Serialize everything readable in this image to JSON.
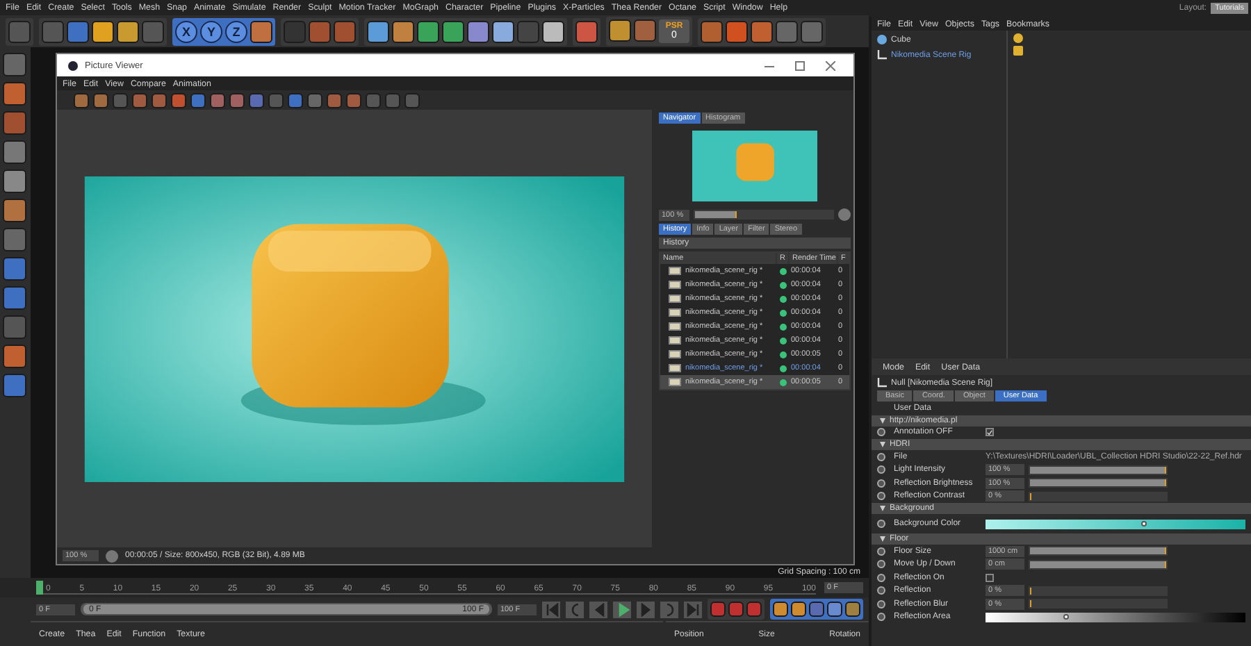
{
  "menu_bar": [
    "File",
    "Edit",
    "Create",
    "Select",
    "Tools",
    "Mesh",
    "Snap",
    "Animate",
    "Simulate",
    "Render",
    "Sculpt",
    "Motion Tracker",
    "MoGraph",
    "Character",
    "Pipeline",
    "Plugins",
    "X-Particles",
    "Thea Render",
    "Octane",
    "Script",
    "Window",
    "Help"
  ],
  "axis_buttons": [
    {
      "label": "X",
      "selected": true
    },
    {
      "label": "Y",
      "selected": true
    },
    {
      "label": "Z",
      "selected": true
    }
  ],
  "psr_badge": {
    "label": "PSR",
    "value": "0"
  },
  "layout": {
    "label": "Layout:",
    "value": "Tutorials"
  },
  "viewport": {
    "grid_spacing": "Grid Spacing : 100 cm"
  },
  "picture_viewer": {
    "title": "Picture Viewer",
    "menu": [
      "File",
      "Edit",
      "View",
      "Compare",
      "Animation"
    ],
    "zoom": "100 %",
    "status": "00:00:05 / Size: 800x450, RGB (32 Bit), 4.89 MB",
    "navigator_tabs": [
      {
        "label": "Navigator",
        "selected": true
      },
      {
        "label": "Histogram",
        "selected": false
      }
    ],
    "navigator_zoom": "100 %",
    "navigator_slider": {
      "level": 0.3
    },
    "history_tabs": [
      {
        "label": "History",
        "selected": true
      },
      {
        "label": "Info",
        "selected": false
      },
      {
        "label": "Layer",
        "selected": false
      },
      {
        "label": "Filter",
        "selected": false
      },
      {
        "label": "Stereo",
        "selected": false
      }
    ],
    "history_title": "History",
    "columns": [
      "Name",
      "R",
      "Render Time",
      "F"
    ],
    "rows": [
      {
        "name": "nikomedia_scene_rig *",
        "time": "00:00:04",
        "frame": "0",
        "selected": false,
        "current": false
      },
      {
        "name": "nikomedia_scene_rig *",
        "time": "00:00:04",
        "frame": "0",
        "selected": false,
        "current": false
      },
      {
        "name": "nikomedia_scene_rig *",
        "time": "00:00:04",
        "frame": "0",
        "selected": false,
        "current": false
      },
      {
        "name": "nikomedia_scene_rig *",
        "time": "00:00:04",
        "frame": "0",
        "selected": false,
        "current": false
      },
      {
        "name": "nikomedia_scene_rig *",
        "time": "00:00:04",
        "frame": "0",
        "selected": false,
        "current": false
      },
      {
        "name": "nikomedia_scene_rig *",
        "time": "00:00:04",
        "frame": "0",
        "selected": false,
        "current": false
      },
      {
        "name": "nikomedia_scene_rig *",
        "time": "00:00:05",
        "frame": "0",
        "selected": false,
        "current": false
      },
      {
        "name": "nikomedia_scene_rig *",
        "time": "00:00:04",
        "frame": "0",
        "selected": false,
        "current": true
      },
      {
        "name": "nikomedia_scene_rig *",
        "time": "00:00:05",
        "frame": "0",
        "selected": true,
        "current": false
      }
    ]
  },
  "object_manager": {
    "menu": [
      "File",
      "Edit",
      "View",
      "Objects",
      "Tags",
      "Bookmarks"
    ],
    "objects": [
      {
        "name": "Cube",
        "kind": "cube",
        "selected": false
      },
      {
        "name": "Nikomedia Scene Rig",
        "kind": "null",
        "selected": true
      }
    ]
  },
  "attributes": {
    "menu": [
      "Mode",
      "Edit",
      "User Data"
    ],
    "title": "Null [Nikomedia Scene Rig]",
    "tabs": [
      {
        "label": "Basic",
        "selected": false
      },
      {
        "label": "Coord.",
        "selected": false
      },
      {
        "label": "Object",
        "selected": false
      },
      {
        "label": "User Data",
        "selected": true
      }
    ],
    "section": "User Data",
    "groups": [
      {
        "title": "http://nikomedia.pl",
        "params": [
          {
            "kind": "check",
            "label": "Annotation OFF",
            "checked": true
          }
        ]
      },
      {
        "title": "HDRI",
        "params": [
          {
            "kind": "text",
            "label": "File",
            "value": "Y:\\Textures\\HDRI\\Loader\\UBL_Collection HDRI Studio\\22-22_Ref.hdr"
          },
          {
            "kind": "slider",
            "label": "Light Intensity",
            "value": "100 %",
            "level": 1
          },
          {
            "kind": "slider",
            "label": "Reflection Brightness",
            "value": "100 %",
            "level": 1
          },
          {
            "kind": "slider",
            "label": "Reflection Contrast",
            "value": "0 %",
            "level": 0
          }
        ]
      },
      {
        "title": "Background",
        "params": [
          {
            "kind": "gradient",
            "label": "Background Color",
            "level": 0.6
          }
        ]
      },
      {
        "title": "Floor",
        "params": [
          {
            "kind": "slider",
            "label": "Floor Size",
            "value": "1000 cm",
            "level": 1
          },
          {
            "kind": "slider",
            "label": "Move Up / Down",
            "value": "0 cm",
            "level": 1
          },
          {
            "kind": "checkbox",
            "label": "Reflection On",
            "checked": false
          },
          {
            "kind": "slider",
            "label": "Reflection",
            "value": "0 %",
            "level": 0
          },
          {
            "kind": "slider",
            "label": "Reflection Blur",
            "value": "0 %",
            "level": 0
          },
          {
            "kind": "ramp",
            "label": "Reflection Area",
            "level": 0.3
          }
        ]
      }
    ]
  },
  "timeline": {
    "ticks": [
      "0",
      "5",
      "10",
      "15",
      "20",
      "25",
      "30",
      "35",
      "40",
      "45",
      "50",
      "55",
      "60",
      "65",
      "70",
      "75",
      "80",
      "85",
      "90",
      "95",
      "100"
    ],
    "current": "0 F"
  },
  "playback": {
    "start": "0 F",
    "range_start": "0 F",
    "range_end": "100 F",
    "range_slider": {
      "level": 1
    },
    "end": "100 F"
  },
  "material_manager": {
    "menu": [
      "Create",
      "Thea",
      "Edit",
      "Function",
      "Texture"
    ]
  },
  "coordinates": {
    "headers": [
      "Position",
      "Size",
      "Rotation"
    ]
  }
}
